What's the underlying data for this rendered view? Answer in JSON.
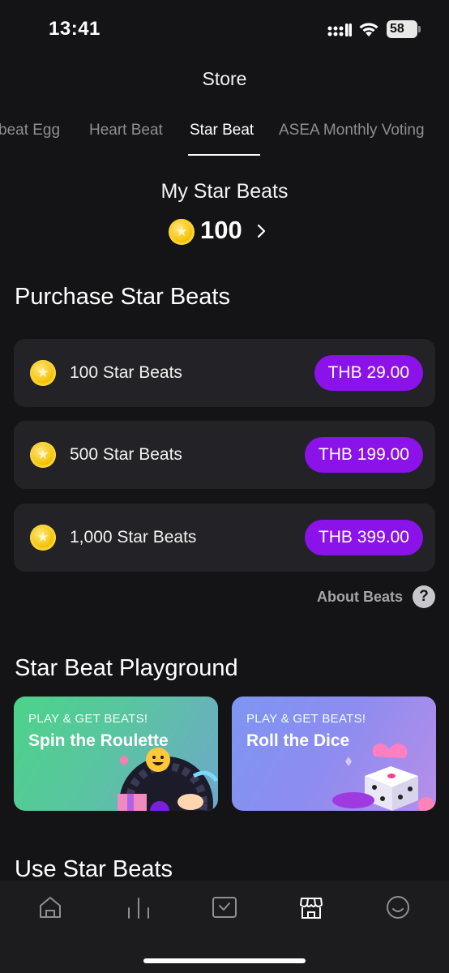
{
  "status_bar": {
    "time": "13:41",
    "battery": "58"
  },
  "header": {
    "title": "Store"
  },
  "tabs": [
    {
      "label": "beat Egg",
      "active": false
    },
    {
      "label": "Heart Beat",
      "active": false
    },
    {
      "label": "Star Beat",
      "active": true
    },
    {
      "label": "ASEA Monthly Voting",
      "active": false
    }
  ],
  "balance": {
    "label": "My Star Beats",
    "value": "100"
  },
  "purchase": {
    "title": "Purchase Star Beats",
    "packages": [
      {
        "label": "100 Star Beats",
        "price": "THB 29.00"
      },
      {
        "label": "500 Star Beats",
        "price": "THB 199.00"
      },
      {
        "label": "1,000 Star Beats",
        "price": "THB 399.00"
      }
    ],
    "about_label": "About Beats",
    "help_glyph": "?"
  },
  "playground": {
    "title": "Star Beat Playground",
    "cards": [
      {
        "kicker": "PLAY & GET BEATS!",
        "title": "Spin the Roulette"
      },
      {
        "kicker": "PLAY & GET BEATS!",
        "title": "Roll the Dice"
      }
    ]
  },
  "use_section": {
    "title": "Use Star Beats"
  },
  "bottom_nav": [
    {
      "icon": "home-icon",
      "active": false
    },
    {
      "icon": "chart-icon",
      "active": false
    },
    {
      "icon": "checkbox-icon",
      "active": false
    },
    {
      "icon": "store-icon",
      "active": true
    },
    {
      "icon": "smile-icon",
      "active": false
    }
  ],
  "colors": {
    "background": "#141416",
    "accent": "#8b12e8",
    "card": "#232327",
    "coin": "#f5c200"
  }
}
